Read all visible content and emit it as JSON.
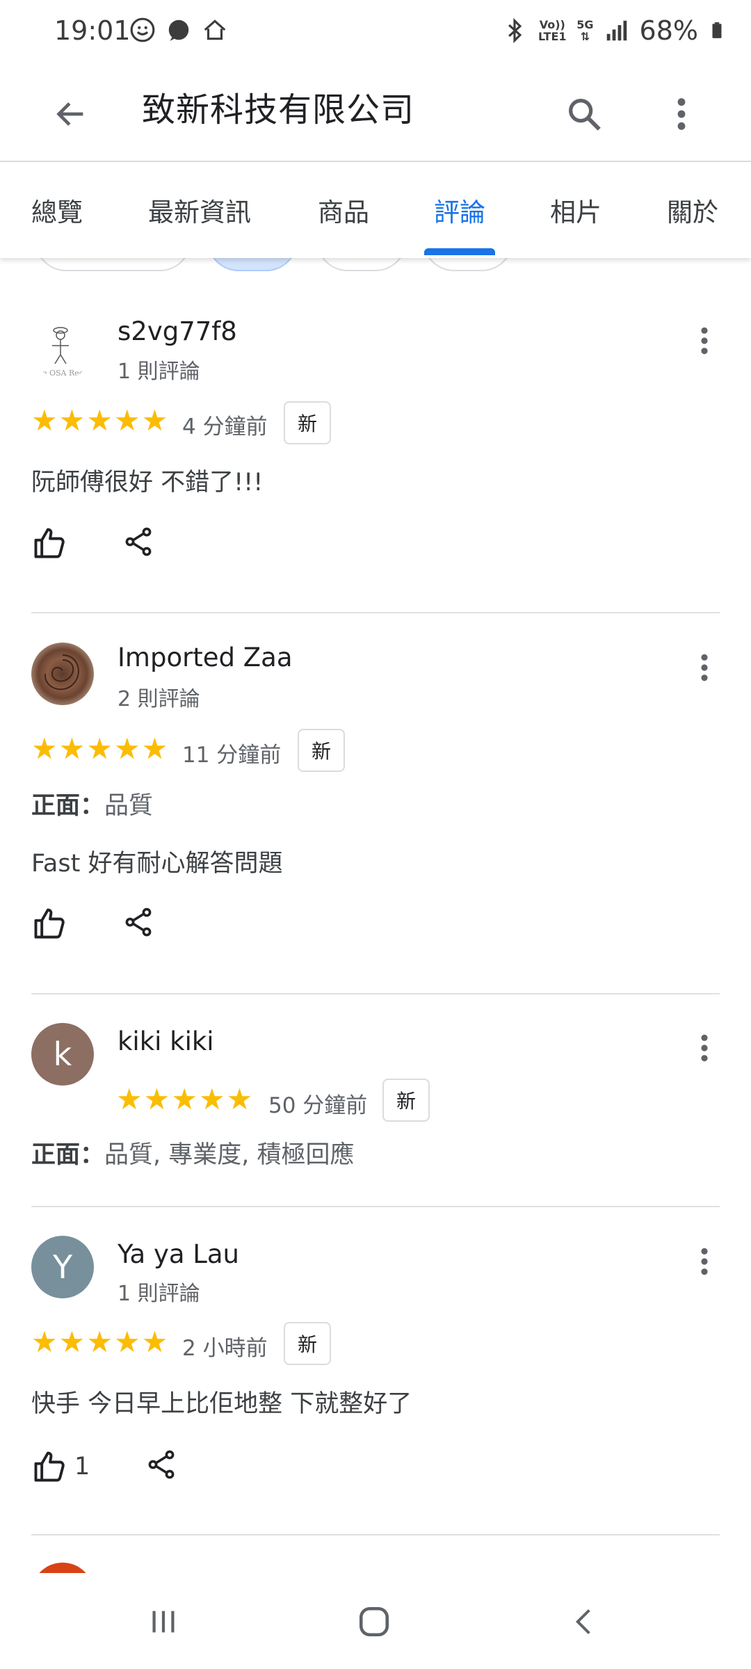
{
  "status": {
    "time": "19:01",
    "volte": "Vo)) LTE1",
    "network": "5G",
    "battery": "68%"
  },
  "appbar": {
    "title": "致新科技有限公司"
  },
  "tabs": [
    {
      "label": "總覽"
    },
    {
      "label": "最新資訊"
    },
    {
      "label": "商品"
    },
    {
      "label": "評論"
    },
    {
      "label": "相片"
    },
    {
      "label": "關於"
    }
  ],
  "reviews": [
    {
      "name": "s2vg77f8",
      "count": "1 則評論",
      "rating": 5,
      "time": "4 分鐘前",
      "badge": "新",
      "text": "阮師傅很好 不錯了!!!"
    },
    {
      "name": "Imported Zaa",
      "count": "2 則評論",
      "rating": 5,
      "time": "11 分鐘前",
      "badge": "新",
      "positive_label": "正面：",
      "positive_value": "品質",
      "text": "Fast 好有耐心解答問題"
    },
    {
      "name": "kiki kiki",
      "avatar_letter": "k",
      "rating": 5,
      "time": "50 分鐘前",
      "badge": "新",
      "positive_label": "正面：",
      "positive_value": "品質, 專業度, 積極回應"
    },
    {
      "name": "Ya ya Lau",
      "avatar_letter": "Y",
      "count": "1 則評論",
      "rating": 5,
      "time": "2 小時前",
      "badge": "新",
      "text": "快手 今日早上比佢地整 下就整好了",
      "likes": "1"
    }
  ],
  "colors": {
    "accent": "#1a73e8",
    "star": "#fbbc04",
    "avatar_k": "#8d6e63",
    "avatar_y": "#78909c"
  }
}
